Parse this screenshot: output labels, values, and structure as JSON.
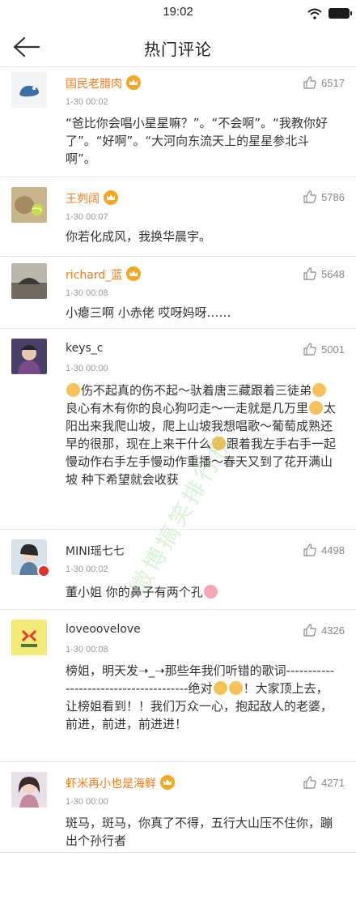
{
  "status_bar": {
    "time": "19:02"
  },
  "header": {
    "title": "热门评论"
  },
  "comments": [
    {
      "username": "国民老腊肉",
      "badge": true,
      "time": "1-30 00:02",
      "likes": "6517",
      "text": "“爸比你会唱小星星嘛？”。“不会啊”。“我教你好了”。“好啊”。“大河向东流天上的星星参北斗啊”。"
    },
    {
      "username": "王刿阔",
      "badge": true,
      "time": "1-30 00:07",
      "likes": "5786",
      "text": "你若化成风，我换华晨宇。"
    },
    {
      "username": "richard_蓝",
      "badge": true,
      "time": "1-30 00:08",
      "likes": "5648",
      "text": "小瘪三啊  小赤佬    哎呀妈呀……"
    },
    {
      "username": "keys_c",
      "badge": false,
      "time": "1-30 00:00",
      "likes": "5001",
      "text_parts": [
        "伤不起真的伤不起～驮着唐三藏跟着三徒弟",
        "良心有木有你的良心狗叼走～一走就是几万里",
        "太阳出来我爬山坡，爬上山坡我想唱歌～葡萄成熟还早的很那，现在上来干什么",
        "跟着我左手右手一起慢动作右手左手慢动作重播～春天又到了花开满山坡 种下希望就会收获"
      ]
    },
    {
      "username": "MINI瑶七七",
      "badge": false,
      "time": "1-30 00:02",
      "likes": "4498",
      "text": "董小姐 你的鼻子有两个孔"
    },
    {
      "username": "loveoovelove",
      "badge": false,
      "time": "1-30 00:08",
      "likes": "4326",
      "text_a": "榜姐，明天发➝_➝那些年我们听错的歌词---------------------------------------绝对",
      "text_b": "！大家顶上去，让榜姐看到！！我们万众一心，抱起敌人的老婆，前进，前进，前进进！"
    },
    {
      "username": "虾米再小也是海鲜",
      "badge": true,
      "time": "1-30 00:00",
      "likes": "4271",
      "text": "斑马，斑马，你真了不得，五行大山压不住你，蹦出个孙行者"
    }
  ],
  "watermark": "微博搞笑排行榜",
  "colors": {
    "username_highlight": "#f27b1c",
    "badge": "#f5a623",
    "text": "#333333",
    "meta": "#999999"
  }
}
